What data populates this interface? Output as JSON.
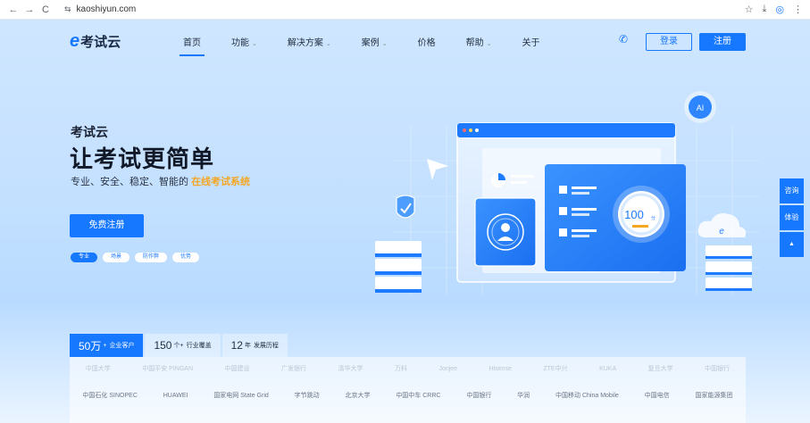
{
  "browser": {
    "url": "kaoshiyun.com",
    "back_icon": "←",
    "forward_icon": "→",
    "reload_icon": "C",
    "tune_icon": "⇆",
    "star_icon": "☆",
    "download_icon": "⤓",
    "profile_icon": "◎",
    "more_icon": "⋮"
  },
  "header": {
    "logo_mark": "e",
    "logo_text": "考试云",
    "menu": [
      {
        "label": "首页",
        "caret": ""
      },
      {
        "label": "功能",
        "caret": "⌄"
      },
      {
        "label": "解决方案",
        "caret": "⌄"
      },
      {
        "label": "案例",
        "caret": "⌄"
      },
      {
        "label": "价格",
        "caret": ""
      },
      {
        "label": "帮助",
        "caret": "⌄"
      },
      {
        "label": "关于",
        "caret": ""
      }
    ],
    "phone_icon": "✆",
    "login_label": "登录",
    "register_label": "注册"
  },
  "hero": {
    "subtitle": "考试云",
    "title": "让考试更简单",
    "desc_prefix": "专业、安全、稳定、智能的 ",
    "desc_highlight": "在线考试系统",
    "free_button": "免费注册",
    "pills": [
      "专业",
      "场景",
      "防作弊",
      "优势"
    ]
  },
  "illustration": {
    "score": "100",
    "score_unit": "分",
    "ai_label": "AI",
    "cloud_label": "e"
  },
  "side_float": {
    "consult_label": "咨询",
    "trial_label": "体验",
    "top_icon": "▲"
  },
  "stats": [
    {
      "value": "50万",
      "unit": "+",
      "label": "企业客户"
    },
    {
      "value": "150",
      "unit": "个+",
      "label": "行业覆盖"
    },
    {
      "value": "12",
      "unit": "年",
      "label": "发展历程"
    }
  ],
  "logos": {
    "row1": [
      "中国大学",
      "中国平安 PINGAN",
      "中国建设",
      "广发银行",
      "清华大学",
      "万科",
      "Jonjee",
      "Hisense",
      "ZTE中兴",
      "KUKA",
      "复旦大学",
      "中国银行"
    ],
    "row2": [
      "中国石化 SINOPEC",
      "HUAWEI",
      "国家电网 State Grid",
      "字节跳动",
      "北京大学",
      "中国中车 CRRC",
      "中国银行",
      "华润",
      "中国移动 China Mobile",
      "中国电信",
      "国家能源集团"
    ]
  },
  "colors": {
    "accent": "#1677ff",
    "highlight": "#f5a623"
  }
}
